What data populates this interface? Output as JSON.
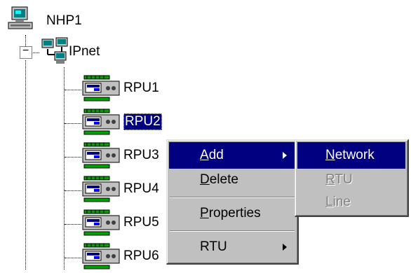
{
  "tree": {
    "root": {
      "label": "NHP1"
    },
    "network": {
      "label": "IPnet",
      "expander": "−"
    },
    "nodes": [
      {
        "label": "RPU1"
      },
      {
        "label": "RPU2"
      },
      {
        "label": "RPU3"
      },
      {
        "label": "RPU4"
      },
      {
        "label": "RPU5"
      },
      {
        "label": "RPU6"
      }
    ]
  },
  "context_menu": {
    "add": {
      "pre": "",
      "accel": "A",
      "post": "dd"
    },
    "delete": {
      "pre": "",
      "accel": "D",
      "post": "elete"
    },
    "properties": {
      "pre": "",
      "accel": "P",
      "post": "roperties"
    },
    "rtu": {
      "label": "RTU"
    }
  },
  "submenu": {
    "network": {
      "pre": "",
      "accel": "N",
      "post": "etwork"
    },
    "rtu": {
      "pre": "",
      "accel": "R",
      "post": "TU"
    },
    "line": {
      "pre": "",
      "accel": "L",
      "post": "ine"
    }
  },
  "colors": {
    "selection": "#000080",
    "menu_face": "#c0c0c0"
  },
  "icons": {
    "root": "computer-icon",
    "network": "network-icon",
    "node": "rpu-device-icon"
  }
}
